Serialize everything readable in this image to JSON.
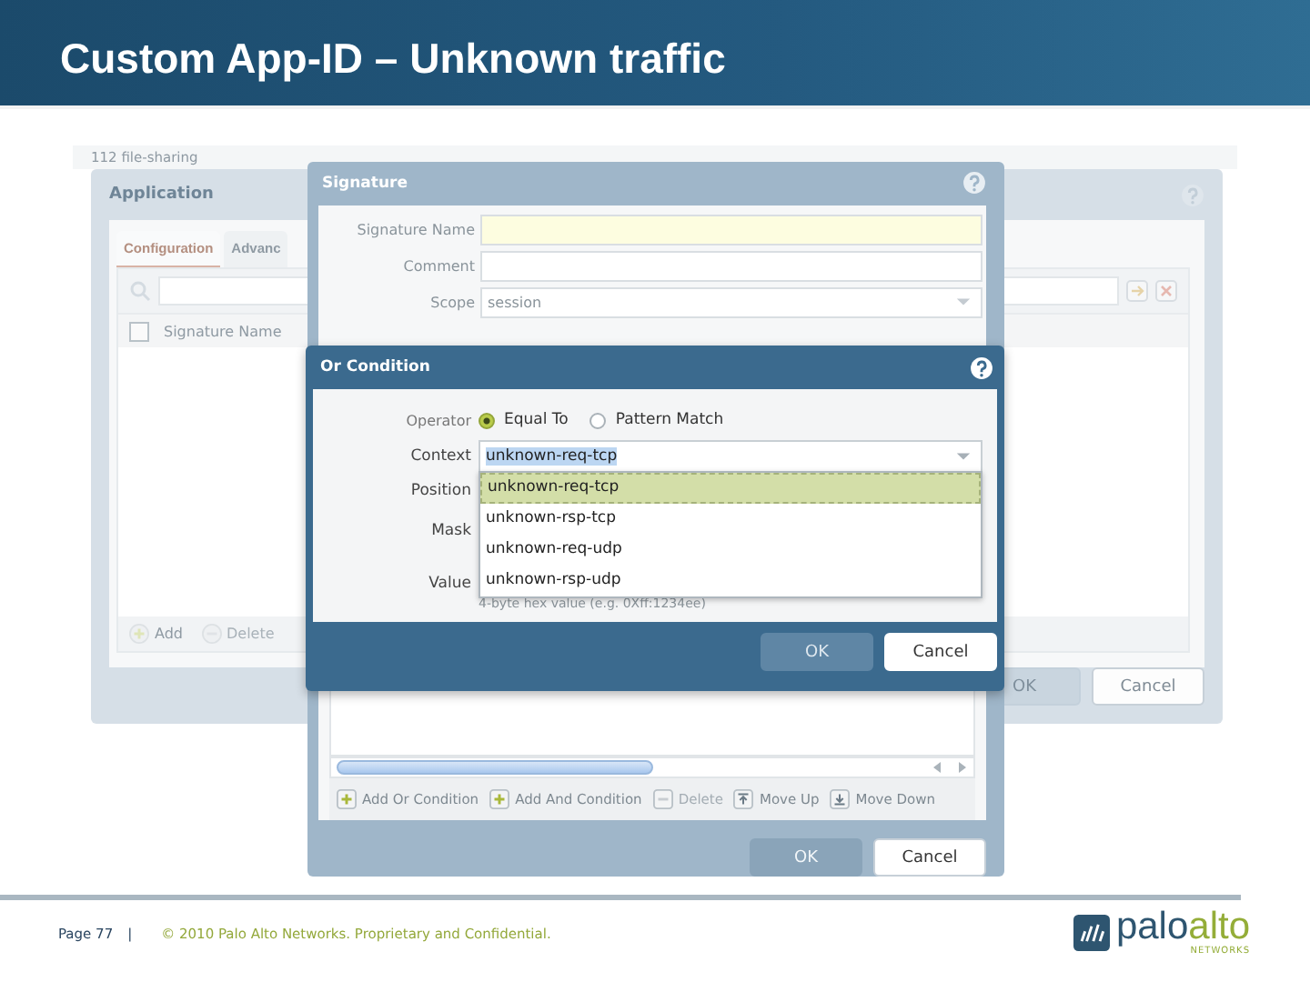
{
  "slide_title": "Custom App-ID – Unknown traffic",
  "background_strip": "112 file-sharing",
  "application": {
    "title": "Application",
    "tabs": [
      {
        "label": "Configuration",
        "selected": true
      },
      {
        "label": "Advanc",
        "selected": false
      }
    ],
    "header_checked": false,
    "column": "Signature Name",
    "footer_buttons": [
      {
        "label": "Add",
        "kind": "plus",
        "disabled": false
      },
      {
        "label": "Delete",
        "kind": "minus",
        "disabled": true
      }
    ],
    "buttons": [
      {
        "label": "OK",
        "disabled": true
      },
      {
        "label": "Cancel",
        "disabled": false
      }
    ]
  },
  "signature": {
    "title": "Signature",
    "fields": [
      {
        "label": "Signature Name",
        "kind": "required"
      },
      {
        "label": "Comment",
        "kind": "text"
      },
      {
        "label": "Scope",
        "kind": "select",
        "value": "session"
      }
    ],
    "toolbar": [
      {
        "label": "Add Or Condition",
        "kind": "plus",
        "disabled": false
      },
      {
        "label": "Add And Condition",
        "kind": "plus",
        "disabled": false
      },
      {
        "label": "Delete",
        "kind": "minus",
        "disabled": true
      },
      {
        "label": "Move Up",
        "kind": "up",
        "disabled": false
      },
      {
        "label": "Move Down",
        "kind": "down",
        "disabled": false
      }
    ],
    "buttons": [
      {
        "label": "OK",
        "disabled": true
      },
      {
        "label": "Cancel",
        "disabled": false
      }
    ]
  },
  "or_condition": {
    "title": "Or Condition",
    "operator_label": "Operator",
    "radios": [
      {
        "label": "Equal To",
        "selected": true
      },
      {
        "label": "Pattern Match",
        "selected": false
      }
    ],
    "context": {
      "label": "Context",
      "value": "unknown-req-tcp",
      "options": [
        {
          "label": "unknown-req-tcp",
          "selected": true
        },
        {
          "label": "unknown-rsp-tcp",
          "selected": false
        },
        {
          "label": "unknown-req-udp",
          "selected": false
        },
        {
          "label": "unknown-rsp-udp",
          "selected": false
        }
      ]
    },
    "labels": [
      "Position",
      "Mask",
      "Value"
    ],
    "hint": "4-byte hex value (e.g. 0Xff:1234ee)",
    "buttons": [
      {
        "label": "OK",
        "disabled": true
      },
      {
        "label": "Cancel",
        "disabled": false
      }
    ]
  },
  "footer": {
    "page": "Page 77",
    "separator": "|",
    "copyright": "© 2010 Palo Alto Networks. Proprietary and Confidential.",
    "logo_part_1": "palo",
    "logo_part_2": "alto",
    "logo_sub": "NETWORKS"
  }
}
